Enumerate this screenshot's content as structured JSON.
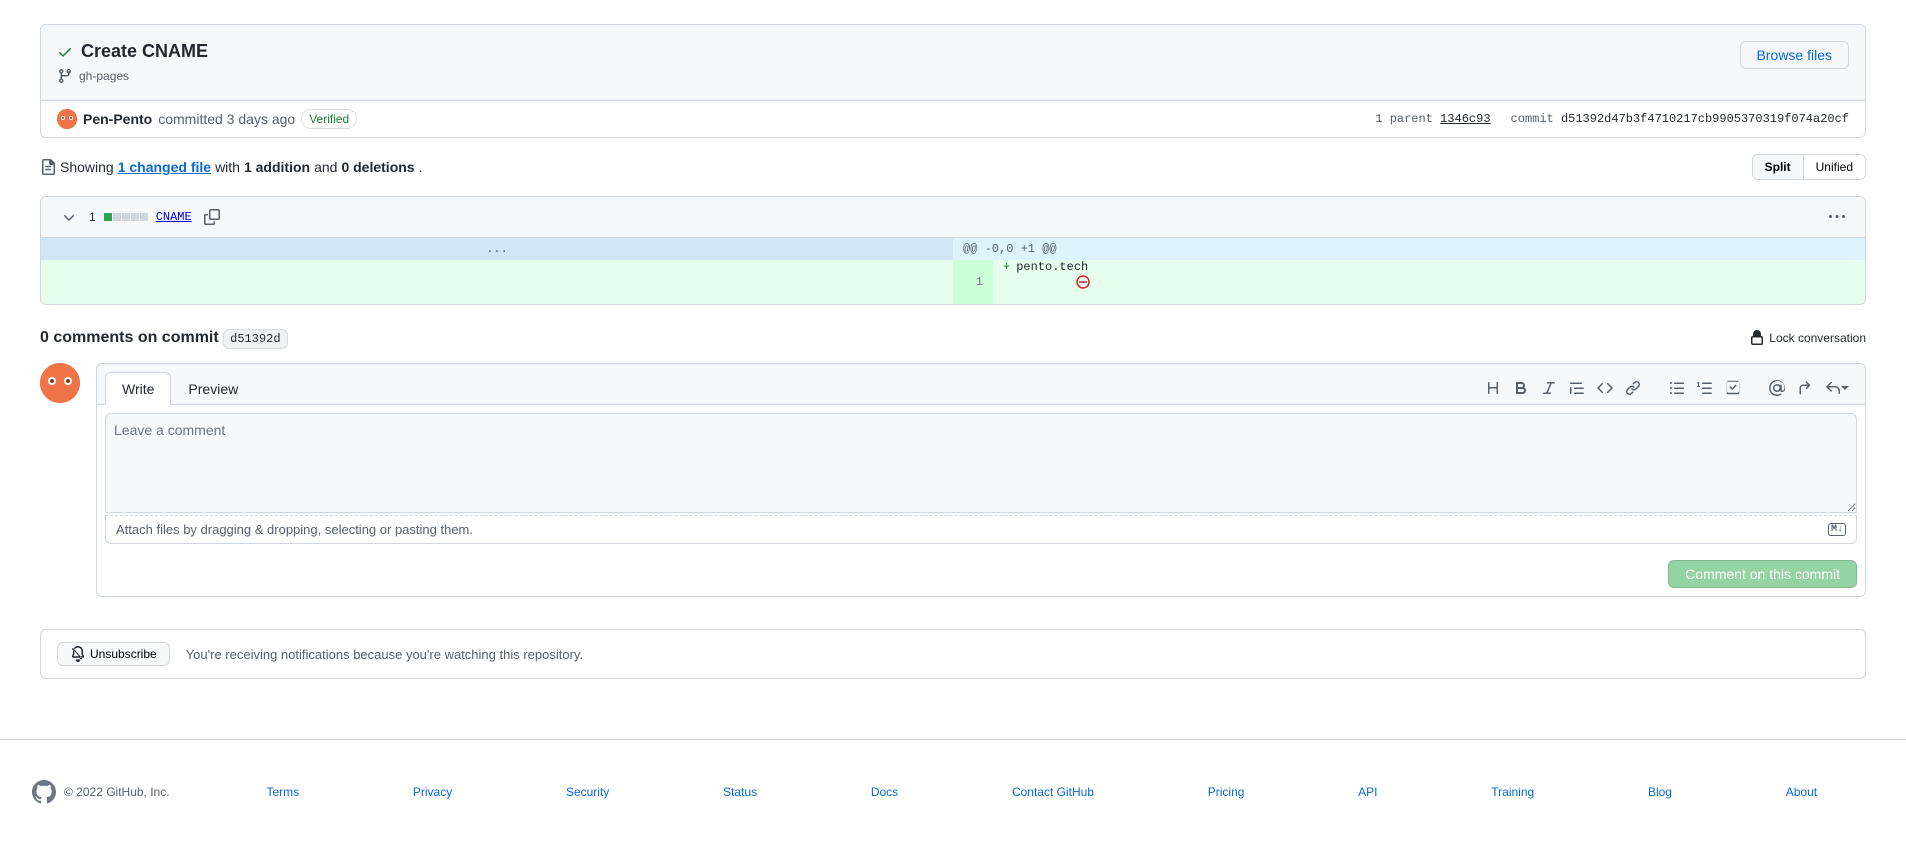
{
  "commit": {
    "title": "Create CNAME",
    "branch": "gh-pages",
    "browse_files_label": "Browse files",
    "author": "Pen-Pento",
    "committed_text": "committed 3 days ago",
    "verified_label": "Verified",
    "parent_label": "1 parent",
    "parent_hash": "1346c93",
    "commit_label": "commit",
    "full_hash": "d51392d47b3f4710217cb9905370319f074a20cf",
    "short_hash": "d51392d"
  },
  "diffstats": {
    "prefix": "Showing",
    "files_link": "1 changed file",
    "with_text": "with",
    "additions": "1 addition",
    "and_text": "and",
    "deletions": "0 deletions",
    "split_label": "Split",
    "unified_label": "Unified"
  },
  "file": {
    "change_count": "1",
    "name": "CNAME",
    "hunk_header": "@@ -0,0 +1 @@",
    "line_number": "1",
    "line_content": "pento.tech"
  },
  "comments": {
    "title_prefix": "0 comments on commit",
    "lock_label": "Lock conversation",
    "write_tab": "Write",
    "preview_tab": "Preview",
    "placeholder": "Leave a comment",
    "attach_hint": "Attach files by dragging & dropping, selecting or pasting them.",
    "submit_label": "Comment on this commit"
  },
  "subscribe": {
    "button_label": "Unsubscribe",
    "text": "You're receiving notifications because you're watching this repository."
  },
  "footer": {
    "copyright": "© 2022 GitHub, Inc.",
    "links": [
      "Terms",
      "Privacy",
      "Security",
      "Status",
      "Docs",
      "Contact GitHub",
      "Pricing",
      "API",
      "Training",
      "Blog",
      "About"
    ]
  }
}
